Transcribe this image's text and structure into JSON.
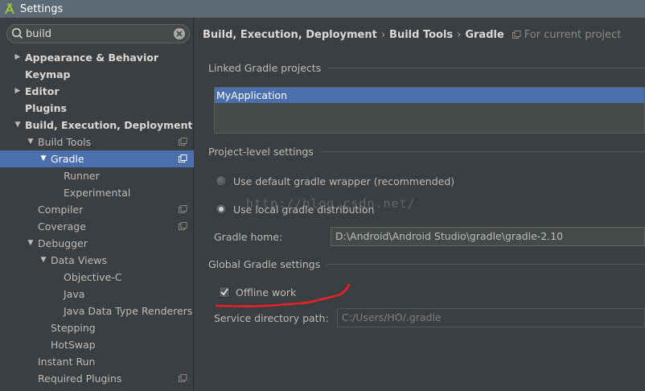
{
  "window": {
    "title": "Settings"
  },
  "colors": {
    "selection": "#4b6eaf",
    "background": "#3c3f41",
    "annotation": "#e8202a"
  },
  "search": {
    "value": "build"
  },
  "tree": [
    {
      "label": "Appearance & Behavior",
      "level": 0,
      "arrow": "right",
      "bold": true,
      "config": false,
      "selected": false
    },
    {
      "label": "Keymap",
      "level": 0,
      "arrow": "",
      "bold": true,
      "config": false,
      "selected": false
    },
    {
      "label": "Editor",
      "level": 0,
      "arrow": "right",
      "bold": true,
      "config": false,
      "selected": false
    },
    {
      "label": "Plugins",
      "level": 0,
      "arrow": "",
      "bold": true,
      "config": false,
      "selected": false
    },
    {
      "label": "Build, Execution, Deployment",
      "level": 0,
      "arrow": "down",
      "bold": true,
      "config": false,
      "selected": false
    },
    {
      "label": "Build Tools",
      "level": 1,
      "arrow": "down",
      "bold": false,
      "config": true,
      "selected": false
    },
    {
      "label": "Gradle",
      "level": 2,
      "arrow": "down",
      "bold": false,
      "config": true,
      "selected": true
    },
    {
      "label": "Runner",
      "level": 3,
      "arrow": "",
      "bold": false,
      "config": false,
      "selected": false
    },
    {
      "label": "Experimental",
      "level": 3,
      "arrow": "",
      "bold": false,
      "config": false,
      "selected": false
    },
    {
      "label": "Compiler",
      "level": 1,
      "arrow": "",
      "bold": false,
      "config": true,
      "selected": false
    },
    {
      "label": "Coverage",
      "level": 1,
      "arrow": "",
      "bold": false,
      "config": true,
      "selected": false
    },
    {
      "label": "Debugger",
      "level": 1,
      "arrow": "down",
      "bold": false,
      "config": false,
      "selected": false
    },
    {
      "label": "Data Views",
      "level": 2,
      "arrow": "down",
      "bold": false,
      "config": false,
      "selected": false
    },
    {
      "label": "Objective-C",
      "level": 3,
      "arrow": "",
      "bold": false,
      "config": false,
      "selected": false
    },
    {
      "label": "Java",
      "level": 3,
      "arrow": "",
      "bold": false,
      "config": false,
      "selected": false
    },
    {
      "label": "Java Data Type Renderers",
      "level": 3,
      "arrow": "",
      "bold": false,
      "config": false,
      "selected": false
    },
    {
      "label": "Stepping",
      "level": 2,
      "arrow": "",
      "bold": false,
      "config": false,
      "selected": false
    },
    {
      "label": "HotSwap",
      "level": 2,
      "arrow": "",
      "bold": false,
      "config": false,
      "selected": false
    },
    {
      "label": "Instant Run",
      "level": 1,
      "arrow": "",
      "bold": false,
      "config": false,
      "selected": false
    },
    {
      "label": "Required Plugins",
      "level": 1,
      "arrow": "",
      "bold": false,
      "config": true,
      "selected": false
    }
  ],
  "breadcrumb": {
    "items": [
      "Build, Execution, Deployment",
      "Build Tools",
      "Gradle"
    ],
    "separator": "›",
    "scope": "For current project"
  },
  "linked": {
    "title": "Linked Gradle projects",
    "items": [
      "MyApplication"
    ]
  },
  "project_level": {
    "title": "Project-level settings",
    "option_wrapper": "Use default gradle wrapper (recommended)",
    "option_local": "Use local gradle distribution",
    "selected": "local",
    "gradle_home_label": "Gradle home:",
    "gradle_home_value": "D:\\Android\\Android Studio\\gradle\\gradle-2.10"
  },
  "global": {
    "title": "Global Gradle settings",
    "offline_label": "Offline work",
    "offline_checked": true,
    "service_dir_label": "Service directory path:",
    "service_dir_value": "C:/Users/HO/.gradle"
  },
  "watermark": "http://blog.csdn.net/"
}
